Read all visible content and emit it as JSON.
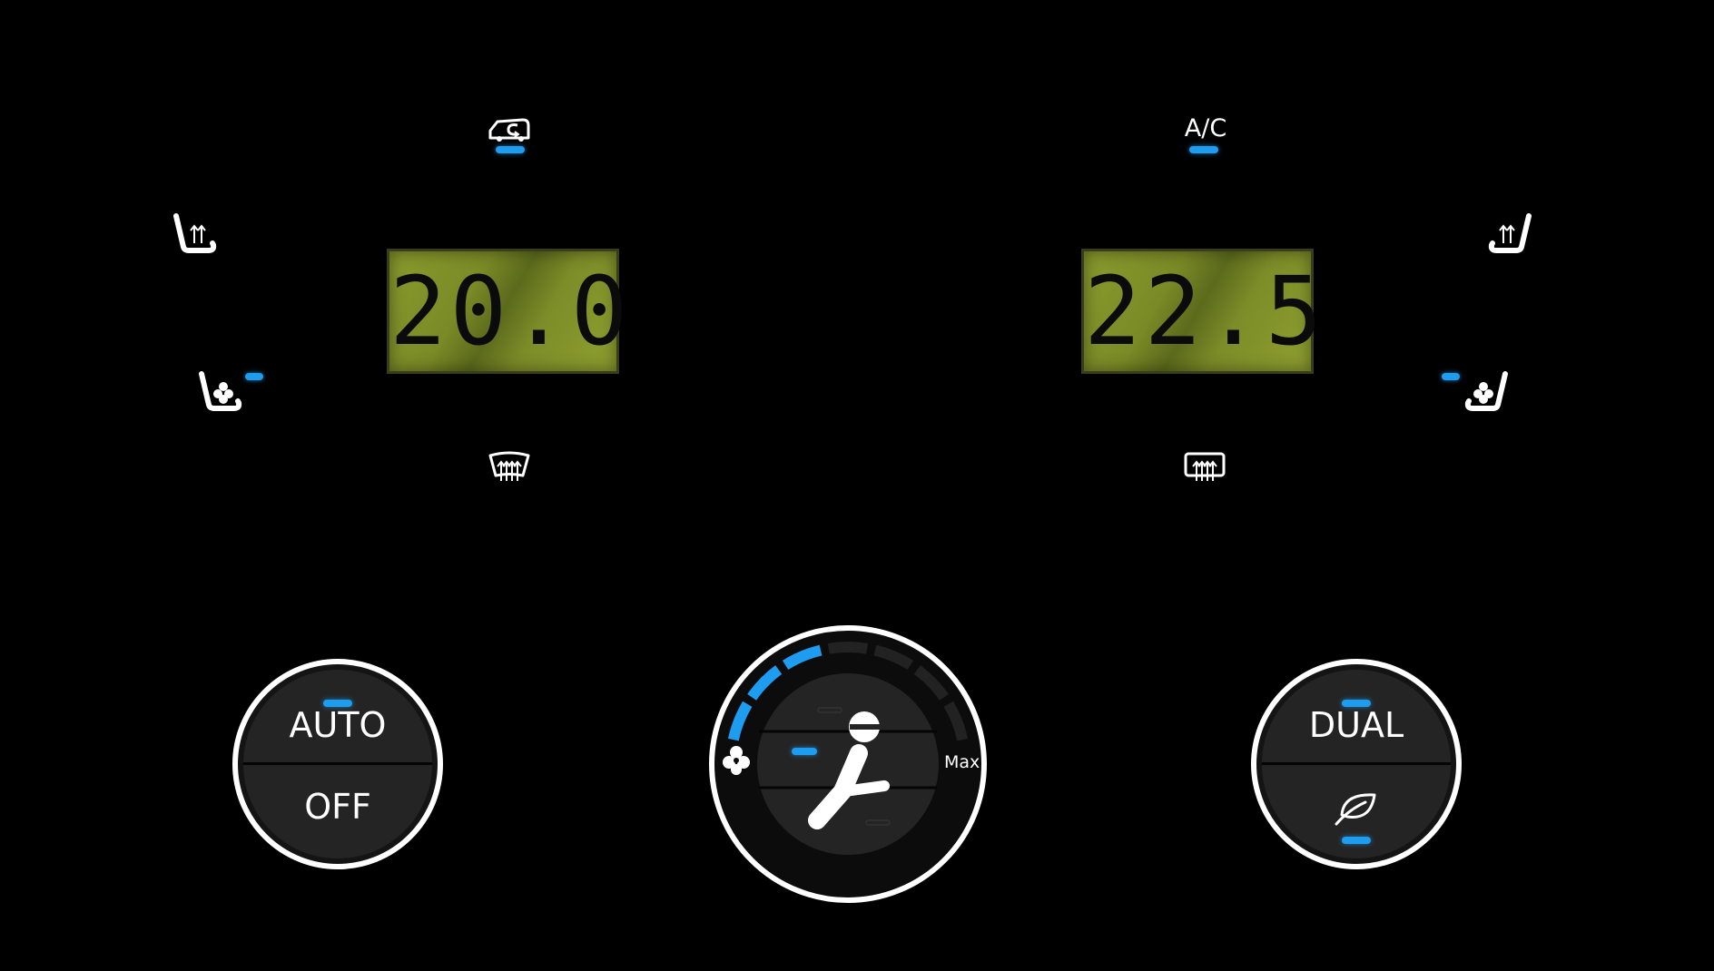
{
  "climate": {
    "left": {
      "temperature": "20.0"
    },
    "right": {
      "temperature": "22.5"
    },
    "ac": {
      "label": "A/C",
      "active": true
    },
    "recirculation": {
      "icon": "car-recirculation-icon",
      "active": true
    },
    "front_defrost": {
      "icon": "front-defrost-icon"
    },
    "rear_defrost": {
      "icon": "rear-defrost-icon"
    },
    "left_seat_heat": {
      "icon": "seat-heat-icon"
    },
    "left_seat_vent": {
      "icon": "seat-ventilation-icon",
      "active": true
    },
    "right_seat_heat": {
      "icon": "seat-heat-icon"
    },
    "right_seat_vent": {
      "icon": "seat-ventilation-icon",
      "active": true
    }
  },
  "auto_knob": {
    "top_label": "AUTO",
    "bottom_label": "OFF",
    "auto_active": true
  },
  "fan_knob": {
    "max_label": "Max",
    "fan_icon": "fan-icon",
    "airflow_icon": "seated-passenger-icon",
    "level": 3,
    "level_max": 7
  },
  "dual_knob": {
    "top_label": "DUAL",
    "bottom_icon": "leaf-eco-icon",
    "dual_active": true,
    "eco_active": true
  },
  "colors": {
    "indicator": "#1e9cf0",
    "lcd_background": "#8a9b2e",
    "background": "#000000"
  }
}
